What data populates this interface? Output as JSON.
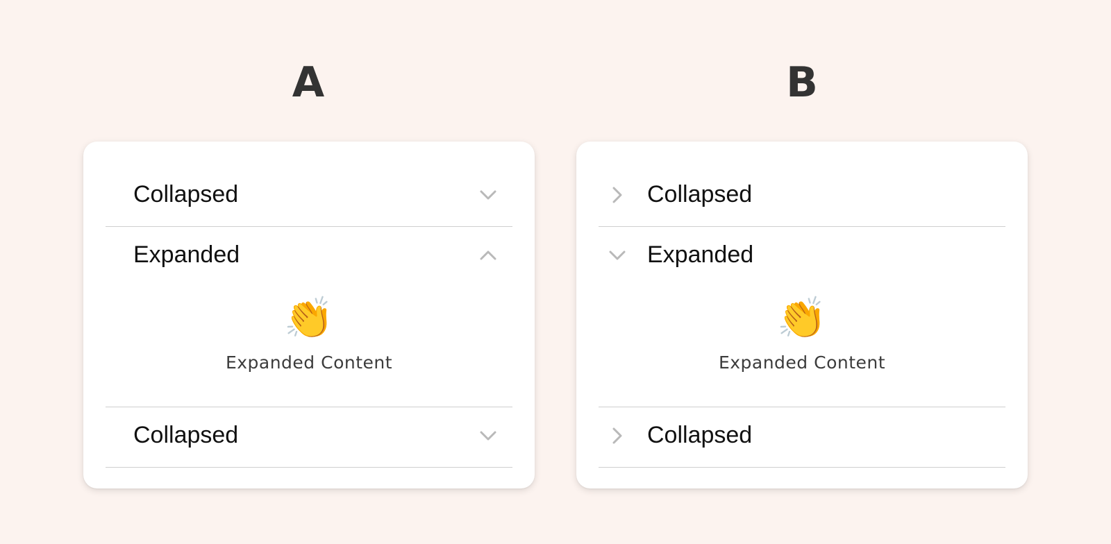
{
  "variants": [
    {
      "title": "A",
      "chevron_position": "right",
      "rows": [
        {
          "label": "Collapsed",
          "state": "collapsed",
          "icon": "chevron-down-icon"
        },
        {
          "label": "Expanded",
          "state": "expanded",
          "icon": "chevron-up-icon",
          "content": {
            "emoji": "👏",
            "text": "Expanded Content"
          }
        },
        {
          "label": "Collapsed",
          "state": "collapsed",
          "icon": "chevron-down-icon"
        }
      ]
    },
    {
      "title": "B",
      "chevron_position": "left",
      "rows": [
        {
          "label": "Collapsed",
          "state": "collapsed",
          "icon": "chevron-right-icon"
        },
        {
          "label": "Expanded",
          "state": "expanded",
          "icon": "chevron-down-icon",
          "content": {
            "emoji": "👏",
            "text": "Expanded Content"
          }
        },
        {
          "label": "Collapsed",
          "state": "collapsed",
          "icon": "chevron-right-icon"
        }
      ]
    }
  ],
  "colors": {
    "background": "#fcf3ef",
    "card": "#ffffff",
    "divider": "#cfcfcf",
    "chevron": "#b9b9b9",
    "title": "#333333"
  }
}
